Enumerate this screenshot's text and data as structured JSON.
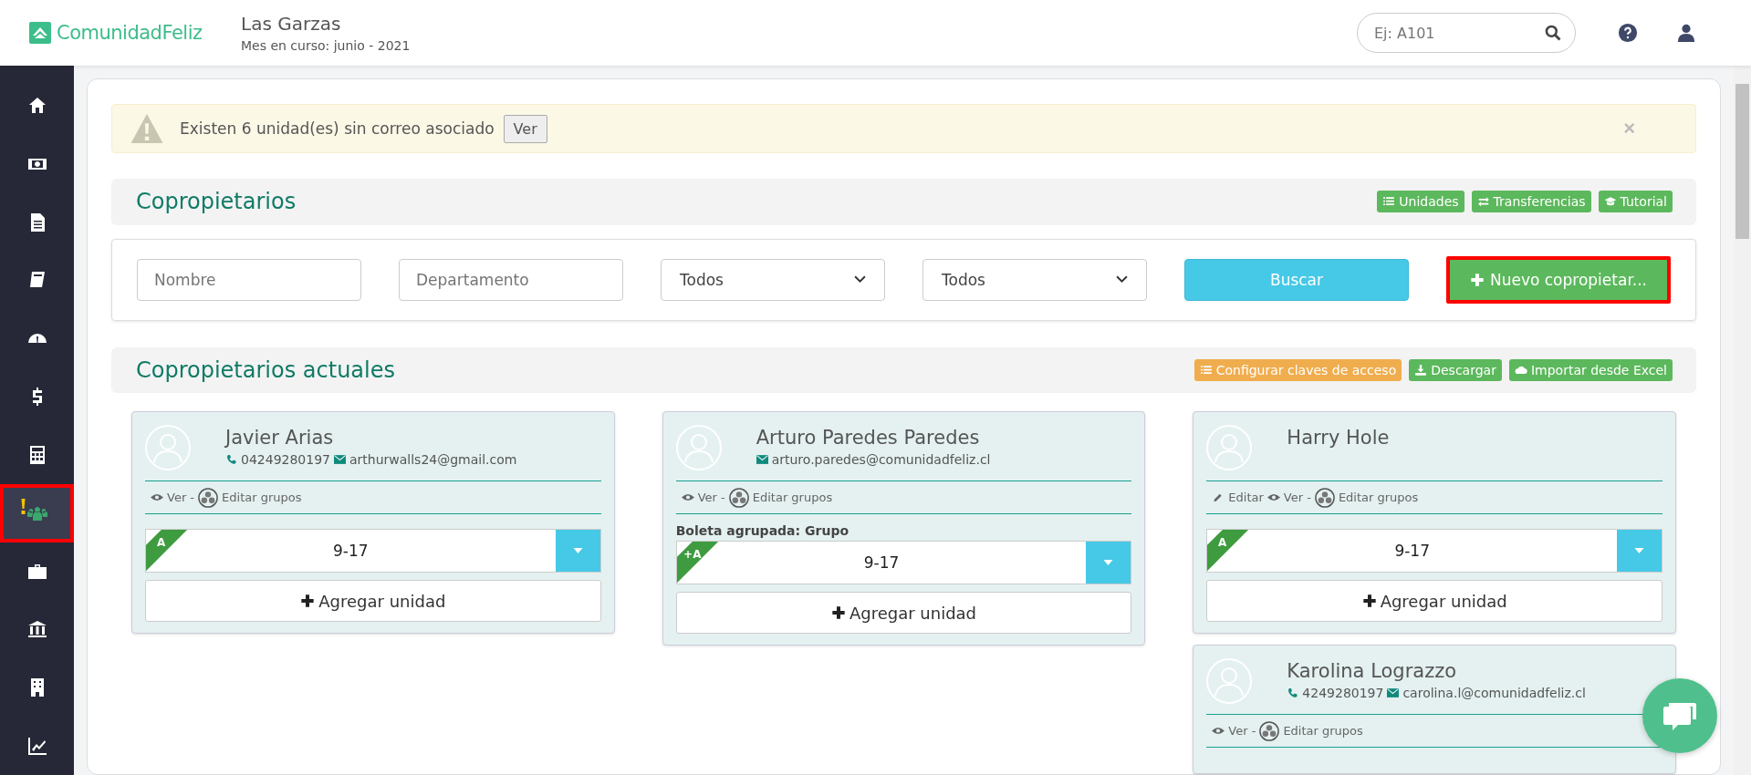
{
  "brand": {
    "name": "ComunidadFeliz"
  },
  "header": {
    "community": "Las Garzas",
    "period": "Mes en curso: junio - 2021",
    "search": {
      "placeholder": "Ej: A101"
    }
  },
  "sidebar": {
    "items": [
      {
        "selected": false,
        "alert": false
      },
      {
        "selected": false,
        "alert": false
      },
      {
        "selected": false,
        "alert": false
      },
      {
        "selected": false,
        "alert": false
      },
      {
        "selected": false,
        "alert": false
      },
      {
        "selected": false,
        "alert": false
      },
      {
        "selected": false,
        "alert": false
      },
      {
        "selected": true,
        "alert": true
      },
      {
        "selected": false,
        "alert": false
      },
      {
        "selected": false,
        "alert": false
      },
      {
        "selected": false,
        "alert": false
      },
      {
        "selected": false,
        "alert": false
      }
    ]
  },
  "alert": {
    "message": "Existen 6 unidad(es) sin correo asociado",
    "button": "Ver",
    "close": "×"
  },
  "section": {
    "title": "Copropietarios",
    "buttons": [
      "Unidades",
      "Transferencias",
      "Tutorial"
    ]
  },
  "filters": {
    "name": {
      "placeholder": "Nombre"
    },
    "department": {
      "placeholder": "Departamento"
    },
    "selects": [
      "Todos",
      "Todos"
    ],
    "search_button": "Buscar",
    "new_button": {
      "label": "Nuevo copropietar...",
      "highlighted": true
    }
  },
  "owners": {
    "title": "Copropietarios actuales",
    "buttons": [
      {
        "label": "Configurar claves de acceso",
        "kind": "warning"
      },
      {
        "label": "Descargar",
        "kind": "success"
      },
      {
        "label": "Importar desde Excel",
        "kind": "success"
      }
    ],
    "columns": [
      [
        {
          "name": "Javier Arias",
          "phone": "04249280197",
          "email": "arthurwalls24@gmail.com",
          "actions": [
            {
              "kind": "view",
              "label": "Ver -"
            },
            {
              "kind": "groups",
              "label": "Editar grupos"
            }
          ],
          "units": [
            {
              "tag": "A",
              "label": "9-17"
            }
          ],
          "add_unit": "Agregar unidad"
        }
      ],
      [
        {
          "name": "Arturo Paredes Paredes",
          "email": "arturo.paredes@comunidadfeliz.cl",
          "actions": [
            {
              "kind": "view",
              "label": "Ver -"
            },
            {
              "kind": "groups",
              "label": "Editar grupos"
            }
          ],
          "group_note": "Boleta agrupada: Grupo",
          "units": [
            {
              "tag": "+A",
              "label": "9-17"
            }
          ],
          "add_unit": "Agregar unidad"
        }
      ],
      [
        {
          "name": "Harry Hole",
          "actions": [
            {
              "kind": "edit",
              "label": "Editar"
            },
            {
              "kind": "view",
              "label": "Ver -"
            },
            {
              "kind": "groups",
              "label": "Editar grupos"
            }
          ],
          "units": [
            {
              "tag": "A",
              "label": "9-17"
            }
          ],
          "add_unit": "Agregar unidad"
        },
        {
          "name": "Karolina Lograzzo",
          "phone": "4249280197",
          "email": "carolina.l@comunidadfeliz.cl",
          "actions": [
            {
              "kind": "view",
              "label": "Ver -"
            },
            {
              "kind": "groups",
              "label": "Editar grupos"
            }
          ]
        }
      ]
    ]
  }
}
